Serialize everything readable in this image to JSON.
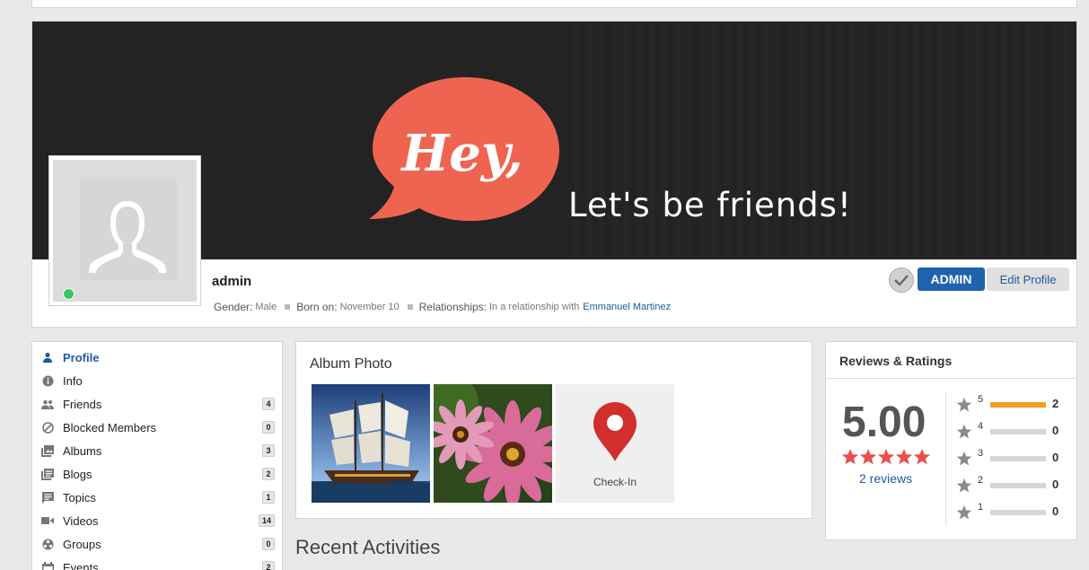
{
  "cover": {
    "bubble_text": "Hey,",
    "tagline": "Let's be friends!"
  },
  "profile": {
    "name": "admin",
    "gender_label": "Gender:",
    "gender_value": "Male",
    "born_label": "Born on:",
    "born_value": "November 10",
    "relationship_label": "Relationships:",
    "relationship_value": "In a relationship with",
    "relationship_partner": "Emmanuel Martinez",
    "online": true,
    "admin_button": "ADMIN",
    "edit_button": "Edit Profile"
  },
  "menu": {
    "items": [
      {
        "label": "Profile",
        "icon": "person-icon",
        "count": ""
      },
      {
        "label": "Info",
        "icon": "info-icon",
        "count": ""
      },
      {
        "label": "Friends",
        "icon": "friends-icon",
        "count": "4"
      },
      {
        "label": "Blocked Members",
        "icon": "blocked-icon",
        "count": "0"
      },
      {
        "label": "Albums",
        "icon": "albums-icon",
        "count": "3"
      },
      {
        "label": "Blogs",
        "icon": "blogs-icon",
        "count": "2"
      },
      {
        "label": "Topics",
        "icon": "topics-icon",
        "count": "1"
      },
      {
        "label": "Videos",
        "icon": "video-icon",
        "count": "14"
      },
      {
        "label": "Groups",
        "icon": "groups-icon",
        "count": "0"
      },
      {
        "label": "Events",
        "icon": "calendar-icon",
        "count": "2"
      }
    ]
  },
  "album": {
    "title": "Album Photo",
    "photos": [
      {
        "name": "sailing-ship-photo"
      },
      {
        "name": "pink-flowers-photo"
      },
      {
        "name": "check-in-photo",
        "label": "Check-In"
      }
    ]
  },
  "recent": {
    "title": "Recent Activities"
  },
  "reviews": {
    "title": "Reviews & Ratings",
    "score": "5.00",
    "stars_filled": 5,
    "reviews_link": "2 reviews",
    "rows": [
      {
        "stars": "5",
        "count": "2",
        "fraction": 1.0
      },
      {
        "stars": "4",
        "count": "0",
        "fraction": 0
      },
      {
        "stars": "3",
        "count": "0",
        "fraction": 0
      },
      {
        "stars": "2",
        "count": "0",
        "fraction": 0
      },
      {
        "stars": "1",
        "count": "0",
        "fraction": 0
      }
    ]
  },
  "colors": {
    "accent": "#1e63ae",
    "bubble": "#ee6450",
    "online": "#3fc55e",
    "star": "#e8524a",
    "bar_fill": "#f0a020"
  }
}
